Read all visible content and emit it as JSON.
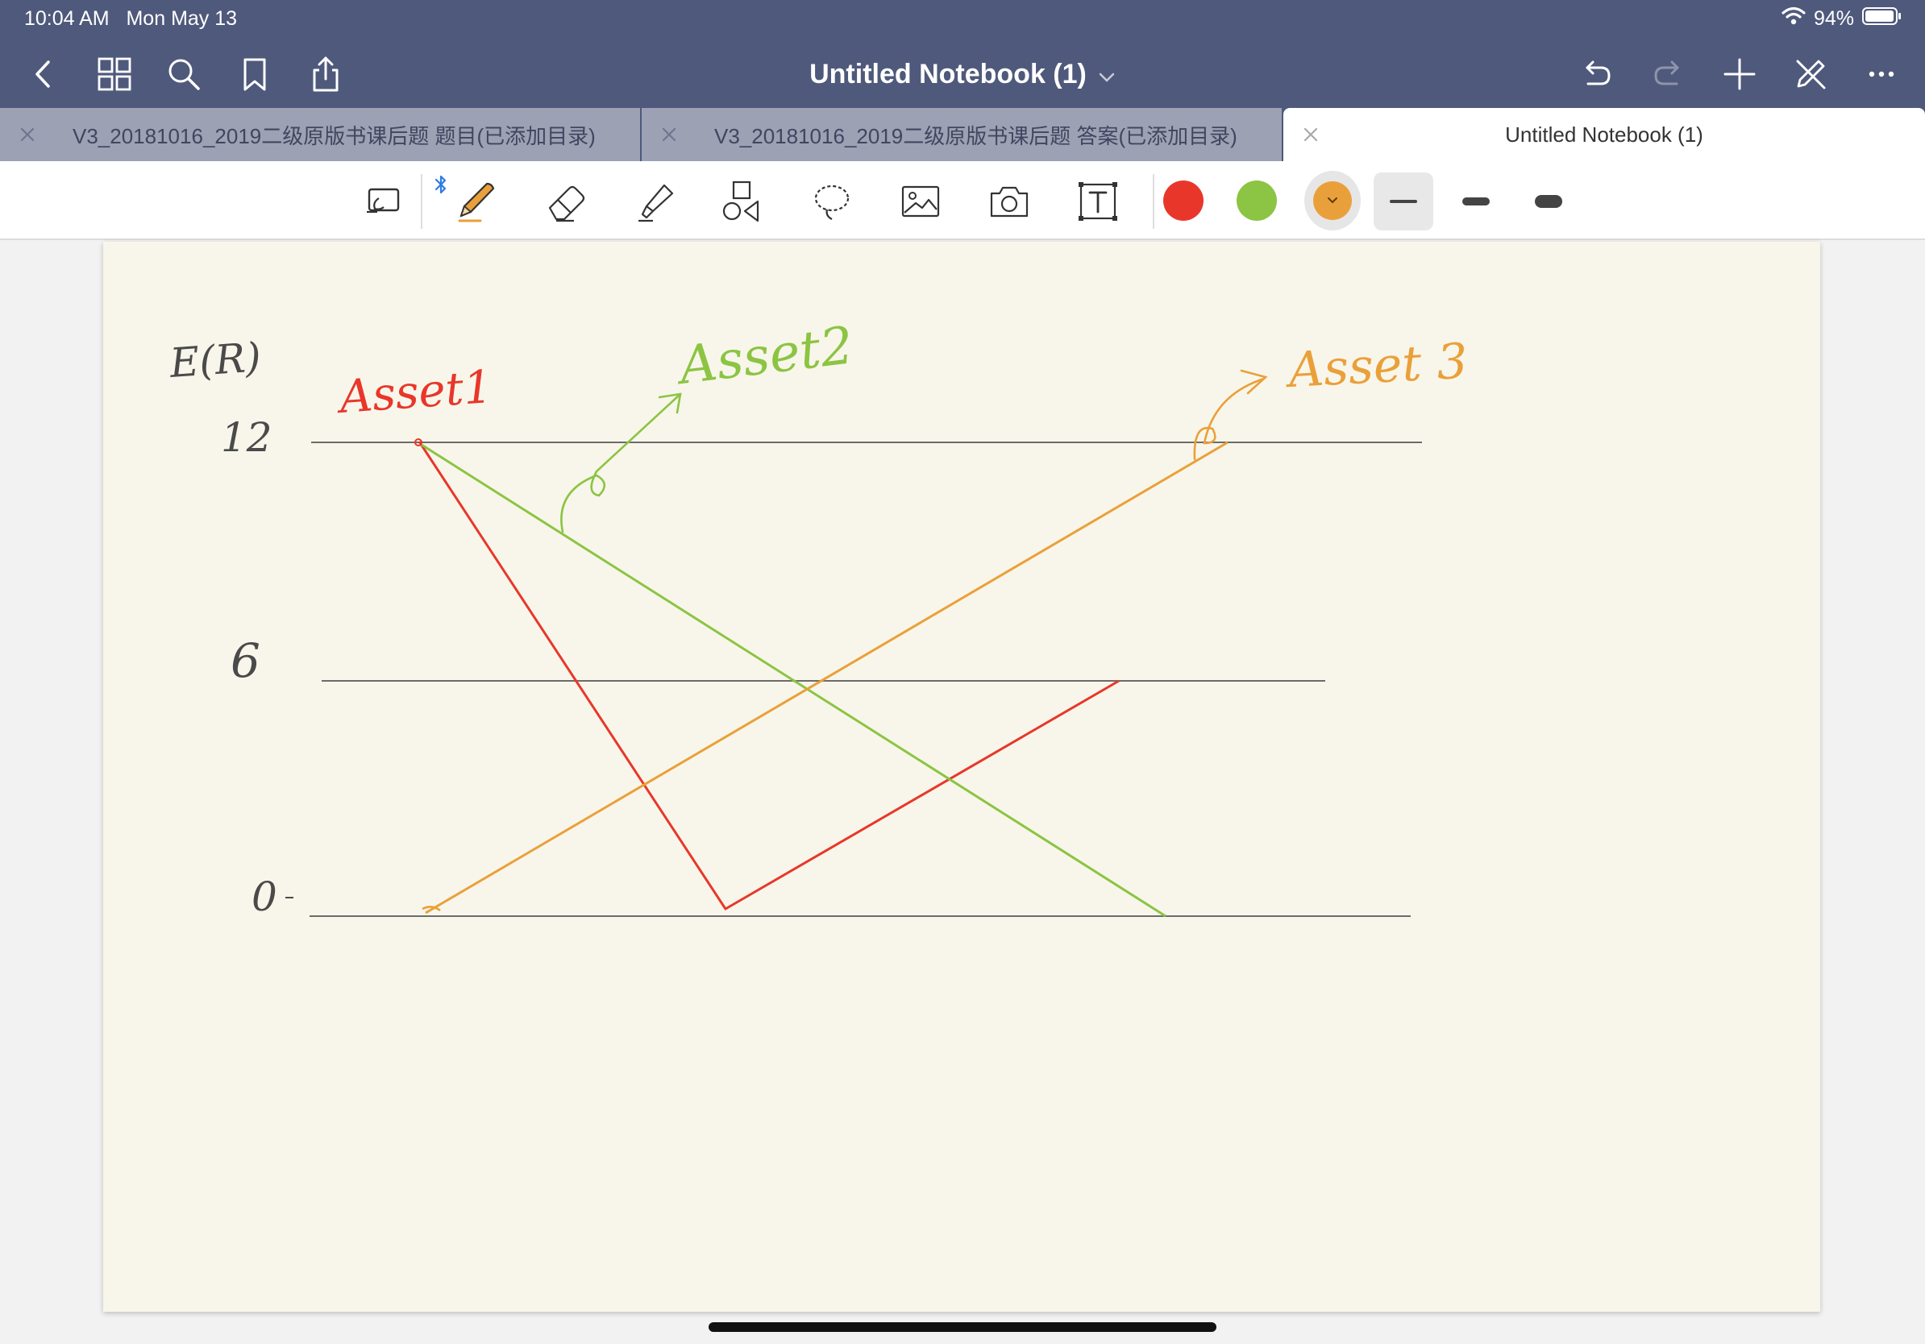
{
  "status_bar": {
    "time": "10:04 AM",
    "date": "Mon May 13",
    "battery": "94%",
    "icons": [
      "wifi-icon",
      "battery-icon"
    ]
  },
  "header": {
    "title": "Untitled Notebook (1)",
    "left_icons": [
      "back-icon",
      "grid-icon",
      "search-icon",
      "bookmark-icon",
      "share-icon"
    ],
    "right_icons": [
      "undo-icon",
      "redo-icon",
      "add-icon",
      "pen-off-icon",
      "more-icon"
    ]
  },
  "tabs": [
    {
      "label": "V3_20181016_2019二级原版书课后题 题目(已添加目录)",
      "active": false
    },
    {
      "label": "V3_20181016_2019二级原版书课后题 答案(已添加目录)",
      "active": false
    },
    {
      "label": "Untitled Notebook (1)",
      "active": true
    }
  ],
  "toolbar": {
    "tools": [
      "read-only-icon",
      "pen-icon",
      "eraser-icon",
      "highlighter-icon",
      "shapes-icon",
      "lasso-icon",
      "image-icon",
      "camera-icon",
      "text-icon"
    ],
    "bluetooth_icon": "bluetooth-icon",
    "colors": [
      "#e8372a",
      "#8cc443",
      "#eaa03a"
    ],
    "selected_color": "#eaa03a",
    "stroke_sizes": [
      "fine",
      "medium",
      "thick"
    ],
    "selected_size": "fine"
  },
  "notebook": {
    "y_axis_label": "E(R)",
    "tick_12": "12",
    "tick_6": "6",
    "tick_0": "0",
    "asset1_label": "Asset1",
    "asset2_label": "Asset2",
    "asset3_label": "Asset 3",
    "ink_colors": {
      "asset1": "#e8372a",
      "asset2": "#8cc443",
      "asset3": "#eaa03a",
      "axis": "#6b6b6b"
    }
  }
}
